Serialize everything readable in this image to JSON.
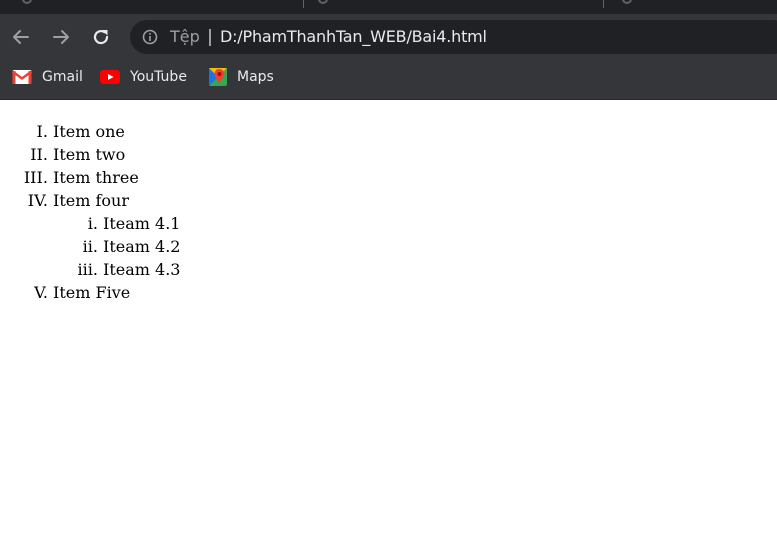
{
  "toolbar": {
    "site_label": "Tệp",
    "url": "D:/PhamThanhTan_WEB/Bai4.html"
  },
  "bookmarks": [
    {
      "label": "Gmail",
      "icon": "gmail-icon"
    },
    {
      "label": "YouTube",
      "icon": "youtube-icon"
    },
    {
      "label": "Maps",
      "icon": "maps-icon"
    }
  ],
  "list": {
    "items": [
      "Item one",
      "Item two",
      "Item three",
      "Item four",
      "Item Five"
    ],
    "subitems": [
      "Iteam 4.1",
      "Iteam 4.2",
      "Iteam 4.3"
    ]
  },
  "colors": {
    "chrome_dark": "#202124",
    "toolbar": "#35363a",
    "youtube_red": "#ff0000",
    "gmail_red": "#ea4335"
  }
}
